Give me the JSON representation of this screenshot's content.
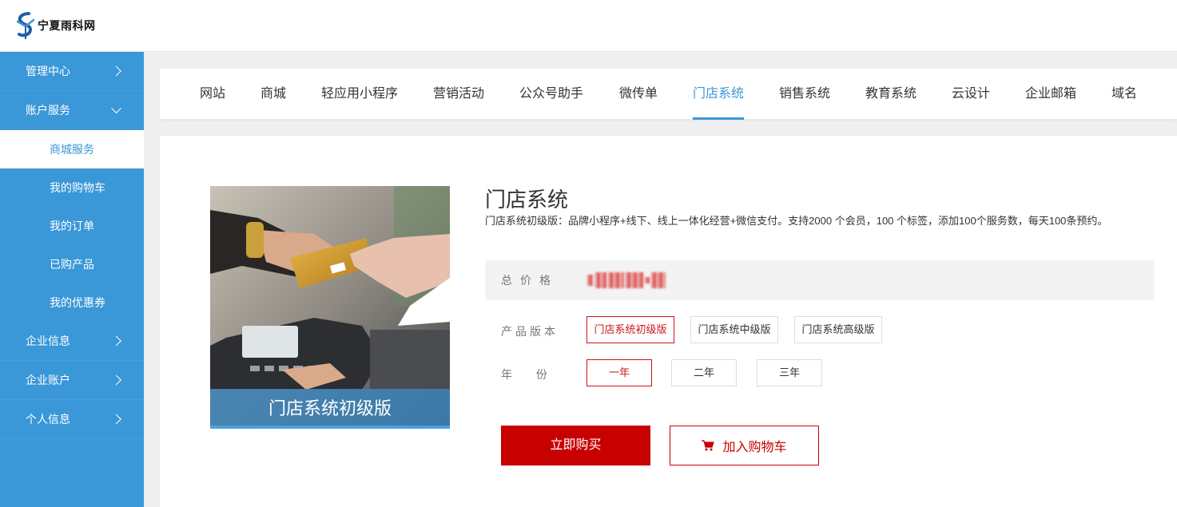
{
  "header": {
    "logo_text": "宁夏雨科网"
  },
  "sidebar": {
    "items": [
      {
        "label": "管理中心"
      },
      {
        "label": "账户服务"
      },
      {
        "label": "企业信息"
      },
      {
        "label": "企业账户"
      },
      {
        "label": "个人信息"
      }
    ],
    "sub_items": [
      {
        "label": "商城服务",
        "active": true
      },
      {
        "label": "我的购物车"
      },
      {
        "label": "我的订单"
      },
      {
        "label": "已购产品"
      },
      {
        "label": "我的优惠券"
      }
    ]
  },
  "tabs": [
    {
      "label": "网站"
    },
    {
      "label": "商城"
    },
    {
      "label": "轻应用小程序"
    },
    {
      "label": "营销活动"
    },
    {
      "label": "公众号助手"
    },
    {
      "label": "微传单"
    },
    {
      "label": "门店系统",
      "active": true
    },
    {
      "label": "销售系统"
    },
    {
      "label": "教育系统"
    },
    {
      "label": "云设计"
    },
    {
      "label": "企业邮箱"
    },
    {
      "label": "域名"
    }
  ],
  "product": {
    "image_caption": "门店系统初级版",
    "title": "门店系统",
    "description": "门店系统初级版：品牌小程序+线下、线上一体化经营+微信支付。支持2000 个会员，100 个标签，添加100个服务数，每天100条预约。",
    "price_label": "总价格",
    "version_label": "产品版本",
    "versions": [
      "门店系统初级版",
      "门店系统中级版",
      "门店系统高级版"
    ],
    "selected_version": "门店系统初级版",
    "year_label": "年 份",
    "years": [
      "一年",
      "二年",
      "三年"
    ],
    "selected_year": "一年",
    "buy_label": "立即购买",
    "cart_label": "加入购物车"
  },
  "colors": {
    "accent": "#3a97d8",
    "primary_red": "#c70000",
    "sidebar_bg": "#3a97d8"
  },
  "icons": {
    "logo": "yukewang-logo-icon",
    "cart": "shopping-cart-icon"
  }
}
